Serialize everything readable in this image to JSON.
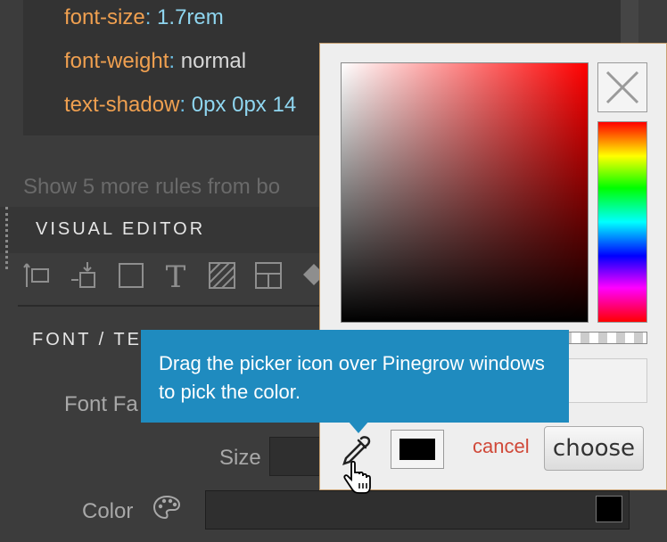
{
  "css_rules": [
    {
      "property": "font-size",
      "value": "1.7rem"
    },
    {
      "property": "font-weight",
      "value": "normal"
    },
    {
      "property": "text-shadow",
      "value": "0px 0px 14"
    }
  ],
  "more_rules_text": "Show 5 more rules from bo",
  "visual_editor": {
    "title": "VISUAL EDITOR",
    "toolbar_icons": [
      "resize-icon",
      "align-icon",
      "box-icon",
      "text-icon",
      "pattern-icon",
      "layout-icon",
      "fill-icon"
    ],
    "font_section_title": "FONT / TE",
    "font_family_label": "Font Fa",
    "size_label": "Size",
    "color_label": "Color",
    "color_value": "#000000"
  },
  "color_picker": {
    "hue_color": "#ff0000",
    "current_color": "#000000",
    "cancel_label": "cancel",
    "choose_label": "choose",
    "tooltip_text": "Drag the picker icon over Pinegrow windows to pick the color."
  }
}
